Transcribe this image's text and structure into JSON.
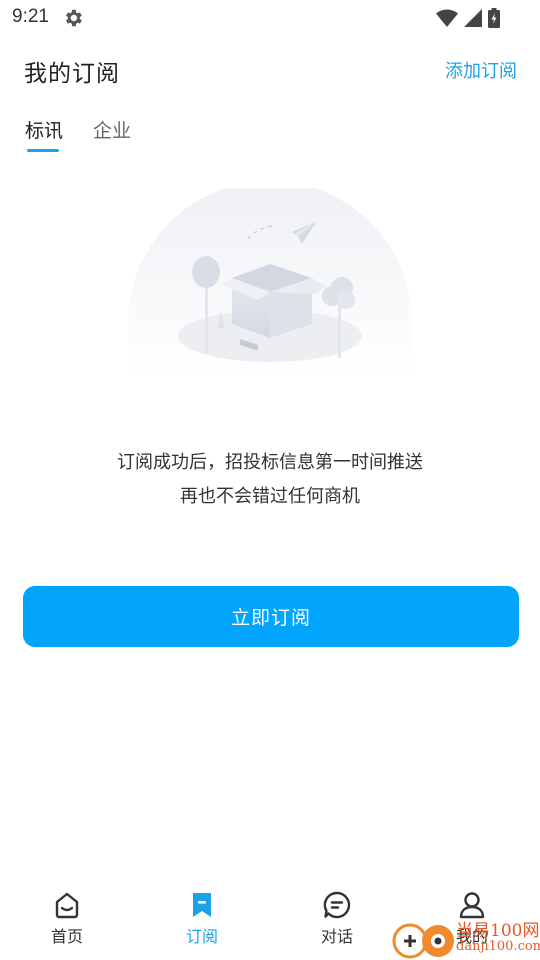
{
  "status_bar": {
    "time": "9:21"
  },
  "header": {
    "title": "我的订阅",
    "add_link": "添加订阅"
  },
  "tabs": [
    {
      "label": "标讯",
      "active": true
    },
    {
      "label": "企业",
      "active": false
    }
  ],
  "empty_state": {
    "line1": "订阅成功后，招投标信息第一时间推送",
    "line2": "再也不会错过任何商机"
  },
  "subscribe_button": {
    "label": "立即订阅"
  },
  "bottom_nav": [
    {
      "label": "首页",
      "icon": "home-icon",
      "active": false
    },
    {
      "label": "订阅",
      "icon": "bookmark-icon",
      "active": true
    },
    {
      "label": "对话",
      "icon": "chat-icon",
      "active": false
    },
    {
      "label": "我的",
      "icon": "user-icon",
      "active": false
    }
  ],
  "watermark": {
    "line1": "当易100网",
    "line2": "danji100.com"
  },
  "colors": {
    "accent": "#1aa3e8",
    "button": "#03a4fb"
  }
}
